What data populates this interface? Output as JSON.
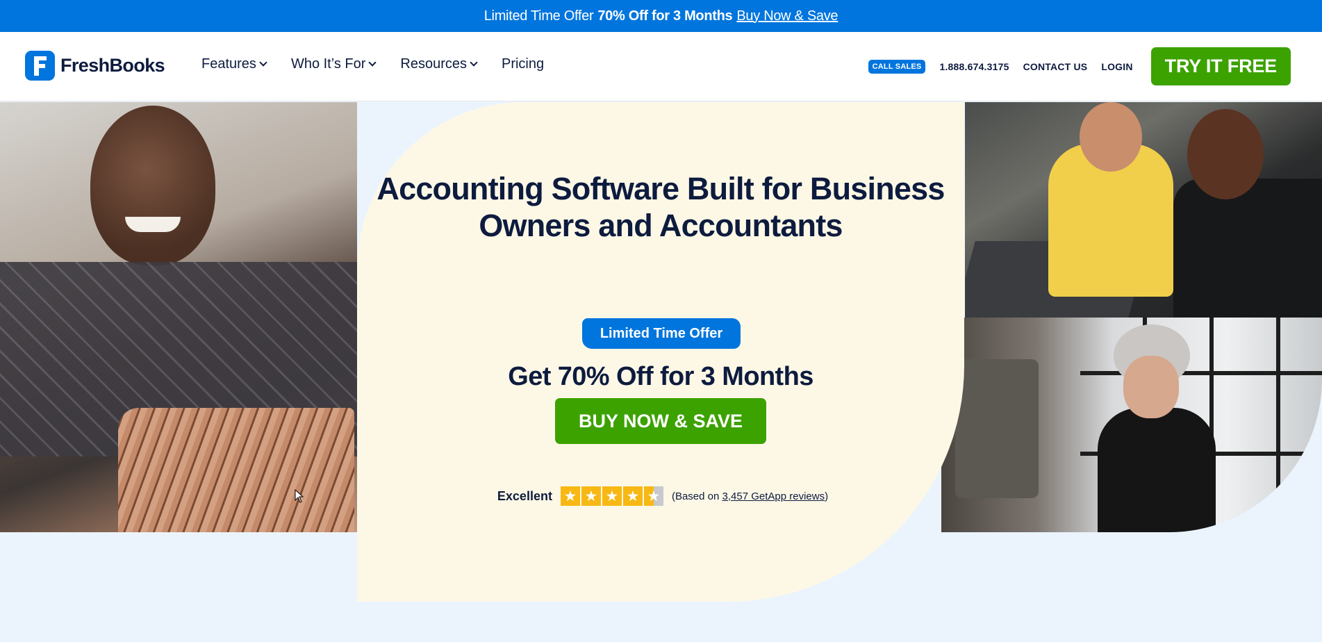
{
  "promo": {
    "text": "Limited Time Offer",
    "bold": "70% Off for 3 Months",
    "link": "Buy Now & Save"
  },
  "nav": {
    "logo_text": "FreshBooks",
    "items": [
      {
        "label": "Features",
        "has_dropdown": true
      },
      {
        "label": "Who It’s For",
        "has_dropdown": true
      },
      {
        "label": "Resources",
        "has_dropdown": true
      },
      {
        "label": "Pricing",
        "has_dropdown": false
      }
    ],
    "call_sales": "CALL SALES",
    "phone": "1.888.674.3175",
    "contact": "CONTACT US",
    "login": "LOGIN",
    "try_free": "TRY IT FREE"
  },
  "hero": {
    "title": "Accounting Software Built for Business Owners and Accountants",
    "offer_pill": "Limited Time Offer",
    "offer_headline": "Get 70% Off for 3 Months",
    "cta": "BUY NOW & SAVE",
    "rating_word": "Excellent",
    "rating_stars": 4.5,
    "rating_prefix": "(Based on ",
    "rating_link": "3,457 GetApp reviews",
    "rating_suffix": ")"
  },
  "colors": {
    "brand_blue": "#0075dd",
    "cta_green": "#3ca200",
    "navy_text": "#0d1b3e",
    "cream": "#fdf8e6",
    "page_bg": "#ebf4fd",
    "star_gold": "#f8b814"
  }
}
